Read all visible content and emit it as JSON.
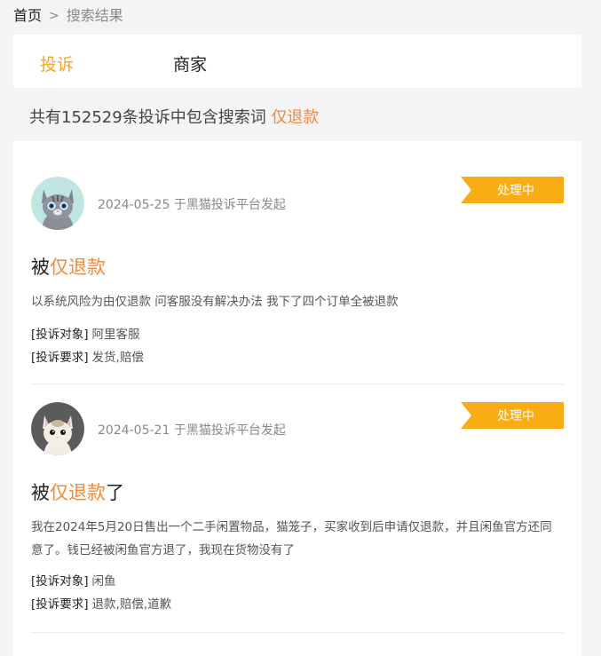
{
  "breadcrumb": {
    "home": "首页",
    "sep": ">",
    "current": "搜索结果"
  },
  "tabs": [
    {
      "label": "投诉",
      "active": true
    },
    {
      "label": "商家",
      "active": false
    }
  ],
  "summary": {
    "prefix": "共有152529条投诉中包含搜索词 ",
    "keyword": "仅退款"
  },
  "colors": {
    "accent": "#f5a623",
    "keyword": "#f08a3c",
    "badge": "#f9ac13"
  },
  "complaints": [
    {
      "date": "2024-05-25",
      "source": "于黑猫投诉平台发起",
      "status": "处理中",
      "title_pre": "被",
      "title_kw": "仅退款",
      "title_post": "",
      "desc": "以系统风险为由仅退款 问客服没有解决办法 我下了四个订单全被退款",
      "target_label": "[投诉对象]",
      "target": "阿里客服",
      "demand_label": "[投诉要求]",
      "demand": "发货,赔偿",
      "avatar_icon": "grey-tabby-cat-avatar"
    },
    {
      "date": "2024-05-21",
      "source": "于黑猫投诉平台发起",
      "status": "处理中",
      "title_pre": "被",
      "title_kw": "仅退款",
      "title_post": "了",
      "desc": "我在2024年5月20日售出一个二手闲置物品，猫笼子，买家收到后申请仅退款，并且闲鱼官方还同意了。钱已经被闲鱼官方退了，我现在货物没有了",
      "target_label": "[投诉对象]",
      "target": "闲鱼",
      "demand_label": "[投诉要求]",
      "demand": "退款,赔偿,道歉",
      "avatar_icon": "white-cat-avatar"
    }
  ]
}
